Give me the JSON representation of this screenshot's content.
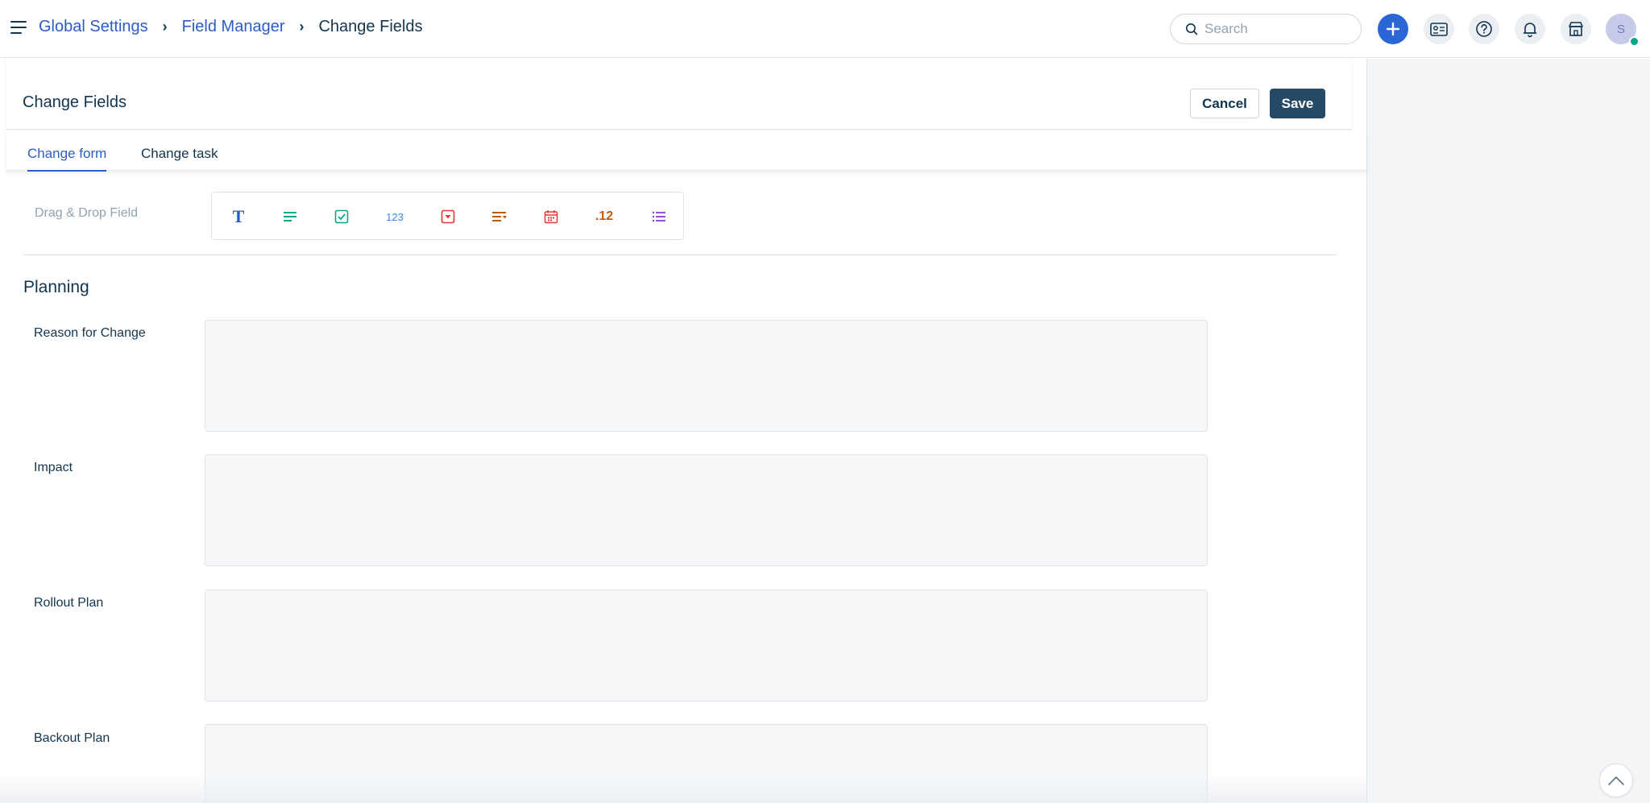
{
  "breadcrumb": {
    "items": [
      "Global Settings",
      "Field Manager"
    ],
    "current": "Change Fields"
  },
  "search": {
    "placeholder": "Search"
  },
  "user": {
    "initial": "S"
  },
  "header": {
    "title": "Change Fields",
    "cancel_label": "Cancel",
    "save_label": "Save"
  },
  "tabs": [
    {
      "label": "Change form",
      "active": true
    },
    {
      "label": "Change task",
      "active": false
    }
  ],
  "drag_drop": {
    "label": "Drag & Drop Field",
    "items": [
      {
        "icon": "text-field-icon",
        "glyph": "T",
        "color": "#2c5cc5"
      },
      {
        "icon": "paragraph-field-icon",
        "color": "#00a886"
      },
      {
        "icon": "checkbox-field-icon",
        "color": "#00a886"
      },
      {
        "icon": "number-field-icon",
        "glyph": "123",
        "color": "#2c8ee6"
      },
      {
        "icon": "dropdown-field-icon",
        "color": "#e43538"
      },
      {
        "icon": "dependent-field-icon",
        "color": "#c65a00"
      },
      {
        "icon": "date-field-icon",
        "color": "#e43538"
      },
      {
        "icon": "decimal-field-icon",
        "glyph": ".12",
        "color": "#c65a00"
      },
      {
        "icon": "multiselect-field-icon",
        "color": "#8f3bd9"
      }
    ]
  },
  "section": {
    "title": "Planning",
    "fields": [
      {
        "label": "Reason for Change"
      },
      {
        "label": "Impact"
      },
      {
        "label": "Rollout Plan"
      },
      {
        "label": "Backout Plan"
      }
    ]
  },
  "colors": {
    "primary": "#2c5cc5",
    "save_button": "#264966",
    "text": "#12344d",
    "field_bg": "#f5f7f9"
  }
}
